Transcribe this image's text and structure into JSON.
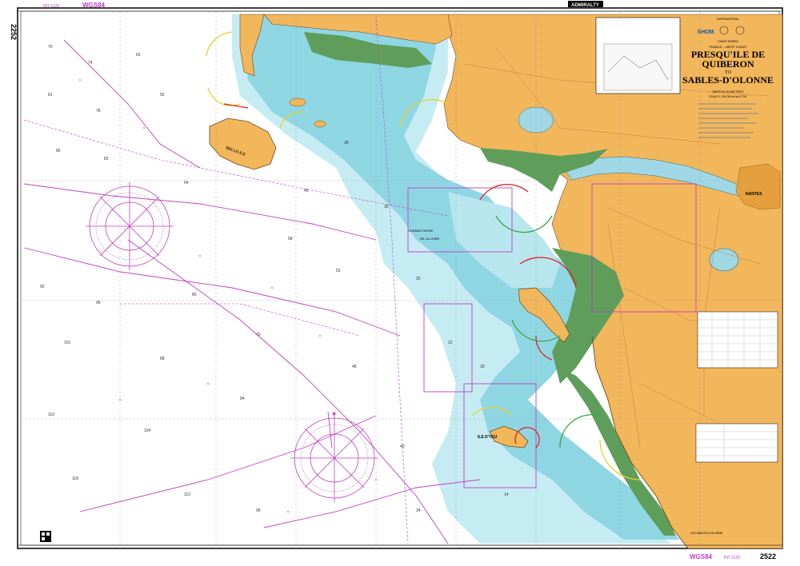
{
  "chart": {
    "number_top_left": "2252",
    "number_bottom_right": "2522",
    "datum_top": "WGS84",
    "datum_bottom": "WGS84",
    "int_top": "INT 1120",
    "int_bottom": "INT 1120",
    "publisher": "ADMIRALTY",
    "series_label": "INTERNATIONAL",
    "shom_logo": "SHOM",
    "chart_series": "CHART SERIES",
    "region": "FRANCE – WEST COAST",
    "title_line1": "PRESQU'ILE DE",
    "title_line2": "QUIBERON",
    "title_to": "TO",
    "title_line3": "SABLES-D'OLONNE",
    "depth_note": "DEPTHS IN METRES",
    "scale_note": "SCALE 1:150 000 at lat 47°00'"
  },
  "places": {
    "nantes": "NANTES",
    "ile_dyeu": "ILE D'YEU",
    "grande_passe": "GRANDE PASSE",
    "de_la_loire": "DE LA LOIRE",
    "belle_ile": "BELLE-ILE",
    "sables": "LES SABLES-D'OLONNE"
  },
  "colors": {
    "land": "#f2b65b",
    "land_dark": "#e59f3d",
    "drying": "#5e9e5a",
    "shallow": "#8fd3e0",
    "mid": "#c3e9f0",
    "deep": "#ffffff",
    "magenta": "#c040c0",
    "frame": "#000000"
  }
}
